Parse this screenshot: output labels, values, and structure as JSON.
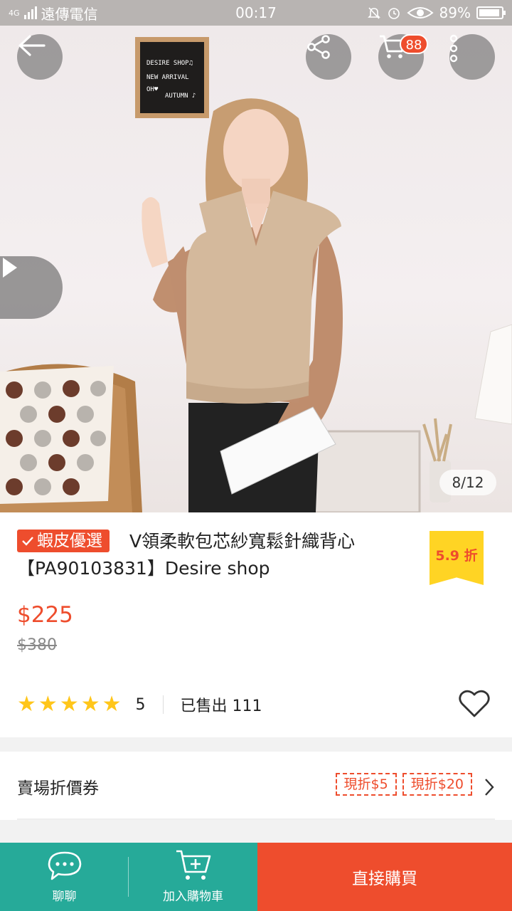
{
  "status_bar": {
    "carrier": "遠傳電信",
    "network": "4G",
    "time": "00:17",
    "battery": "89%"
  },
  "hero": {
    "image_counter": "8/12",
    "cart_badge": "88",
    "sign_lines": [
      "DESIRE SHOP♫",
      "NEW ARRIVAL",
      "OH♥",
      "AUTUMN ♪"
    ],
    "colors": {
      "wall": "#f1ecec",
      "vest": "#d4b99c",
      "shirt": "#bf8e6f",
      "hair": "#c79d72"
    }
  },
  "product": {
    "badge": "蝦皮優選",
    "title": "V領柔軟包芯紗寬鬆針織背心【PA90103831】Desire shop",
    "discount": "5.9 折",
    "price": "$225",
    "original_price": "$380",
    "rating": "5",
    "stars": 5,
    "sold": "已售出 111"
  },
  "voucher": {
    "label": "賣場折價券",
    "tags": [
      "現折$5",
      "現折$20"
    ]
  },
  "bottom_bar": {
    "chat": "聊聊",
    "add_to_cart": "加入購物車",
    "buy_now": "直接購買"
  },
  "colors": {
    "accent": "#ee4d2d",
    "teal": "#26aa99",
    "star": "#ffc61a",
    "discount_bg": "#ffd424"
  }
}
